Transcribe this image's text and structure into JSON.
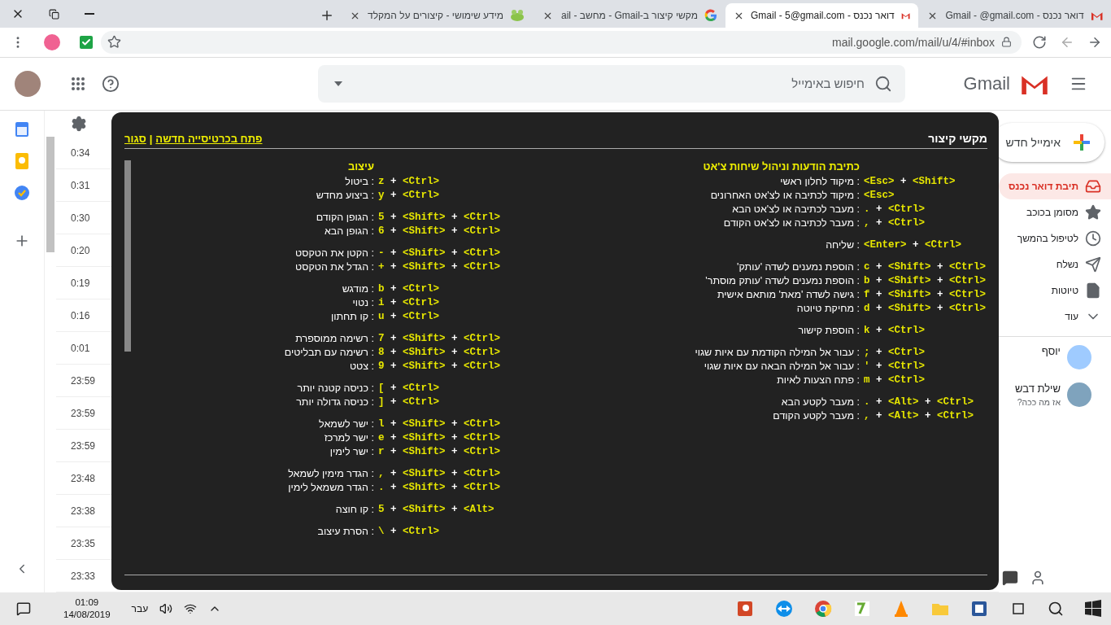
{
  "browser": {
    "tabs": [
      {
        "title": "דואר נכנס - Gmail - @gmail.com",
        "kind": "gmail",
        "selected": false
      },
      {
        "title": "דואר נכנס - Gmail - 5@gmail.com",
        "kind": "gmail",
        "selected": true
      },
      {
        "title": "מקשי קיצור ב-Gmail - מחשב - ail",
        "kind": "google",
        "selected": false
      },
      {
        "title": "מידע שימושי - קיצורים על המקלד",
        "kind": "forum",
        "selected": false
      }
    ],
    "url": "mail.google.com/mail/u/4/#inbox"
  },
  "header": {
    "logo": "Gmail",
    "search_placeholder": "חיפוש באימייל"
  },
  "messages": [
    {
      "time": "0:34"
    },
    {
      "time": "0:31"
    },
    {
      "time": "0:30"
    },
    {
      "time": "0:20"
    },
    {
      "time": "0:19"
    },
    {
      "time": "0:16"
    },
    {
      "time": "0:01"
    },
    {
      "time": "23:59"
    },
    {
      "time": "23:59"
    },
    {
      "time": "23:59"
    },
    {
      "time": "23:48"
    },
    {
      "time": "23:38"
    },
    {
      "time": "23:35"
    },
    {
      "time": "23:33"
    }
  ],
  "sidebar": {
    "compose": "אימייל חדש",
    "items": [
      {
        "label": "תיבת דואר נכנס",
        "kind": "inbox",
        "selected": true
      },
      {
        "label": "מסומן בכוכב",
        "kind": "starred",
        "selected": false
      },
      {
        "label": "לטיפול בהמשך",
        "kind": "snoozed",
        "selected": false
      },
      {
        "label": "נשלח",
        "kind": "sent",
        "selected": false
      },
      {
        "label": "טיוטות",
        "kind": "drafts",
        "selected": false
      },
      {
        "label": "עוד",
        "kind": "more",
        "selected": false
      }
    ],
    "chat": [
      {
        "name": "יוסף",
        "color": "#9fcbff"
      },
      {
        "name": "שילת דבש",
        "status": "אז מה ככה?",
        "color": "#7fa3bd"
      }
    ]
  },
  "shortcuts_dialog": {
    "title": "מקשי קיצור",
    "open_link": "פתח בכרטיסייה חדשה",
    "separator": "|",
    "close_link": "סגור",
    "columns": [
      {
        "heading": "כתיבת הודעות וניהול שיחות צ'אט",
        "groups": [
          [
            {
              "keys": "<Esc> + <Shift>",
              "action": ": מיקוד לחלון ראשי"
            },
            {
              "keys": "<Esc>",
              "action": ": מיקוד לכתיבה או לצ'אט האחרונים"
            },
            {
              "keys": ". + <Ctrl>",
              "action": ": מעבר לכתיבה או לצ'אט הבא"
            },
            {
              "keys": ", + <Ctrl>",
              "action": ": מעבר לכתיבה או לצ'אט הקודם"
            }
          ],
          [
            {
              "keys": "<Enter> + <Ctrl>",
              "action": ": שליחה"
            }
          ],
          [
            {
              "keys": "c + <Shift> + <Ctrl>",
              "action": ": הוספת נמענים לשדה 'עותק'"
            },
            {
              "keys": "b + <Shift> + <Ctrl>",
              "action": ": הוספת נמענים לשדה 'עותק מוסתר'"
            },
            {
              "keys": "f + <Shift> + <Ctrl>",
              "action": ": גישה לשדה 'מאת' מותאם אישית"
            },
            {
              "keys": "d + <Shift> + <Ctrl>",
              "action": ": מחיקת טיוטה"
            }
          ],
          [
            {
              "keys": "k + <Ctrl>",
              "action": ": הוספת קישור"
            }
          ],
          [
            {
              "keys": "; + <Ctrl>",
              "action": ": עבור אל המילה הקודמת עם איות שגוי"
            },
            {
              "keys": "' + <Ctrl>",
              "action": ": עבור אל המילה הבאה עם איות שגוי"
            },
            {
              "keys": "m + <Ctrl>",
              "action": ": פתח הצעות לאיות"
            }
          ],
          [
            {
              "keys": ". + <Alt> + <Ctrl>",
              "action": ": מעבר לקטע הבא"
            },
            {
              "keys": ", + <Alt> + <Ctrl>",
              "action": ": מעבר לקטע הקודם"
            }
          ]
        ]
      },
      {
        "heading": "עיצוב",
        "groups": [
          [
            {
              "keys": "z + <Ctrl>",
              "action": ": ביטול"
            },
            {
              "keys": "y + <Ctrl>",
              "action": ": ביצוע מחדש"
            }
          ],
          [
            {
              "keys": "5 + <Shift> + <Ctrl>",
              "action": ": הגופן הקודם"
            },
            {
              "keys": "6 + <Shift> + <Ctrl>",
              "action": ": הגופן הבא"
            }
          ],
          [
            {
              "keys": "- + <Shift> + <Ctrl>",
              "action": ": הקטן את הטקסט"
            },
            {
              "keys": "+ + <Shift> + <Ctrl>",
              "action": ": הגדל את הטקסט"
            }
          ],
          [
            {
              "keys": "b + <Ctrl>",
              "action": ": מודגש"
            },
            {
              "keys": "i + <Ctrl>",
              "action": ": נטוי"
            },
            {
              "keys": "u + <Ctrl>",
              "action": ": קו תחתון"
            }
          ],
          [
            {
              "keys": "7 + <Shift> + <Ctrl>",
              "action": ": רשימה ממוספרת"
            },
            {
              "keys": "8 + <Shift> + <Ctrl>",
              "action": ": רשימה עם תבליטים"
            },
            {
              "keys": "9 + <Shift> + <Ctrl>",
              "action": ": צטט"
            }
          ],
          [
            {
              "keys": "[ + <Ctrl>",
              "action": ": כניסה קטנה יותר"
            },
            {
              "keys": "] + <Ctrl>",
              "action": ": כניסה גדולה יותר"
            }
          ],
          [
            {
              "keys": "l + <Shift> + <Ctrl>",
              "action": ": ישר לשמאל"
            },
            {
              "keys": "e + <Shift> + <Ctrl>",
              "action": ": ישר למרכז"
            },
            {
              "keys": "r + <Shift> + <Ctrl>",
              "action": ": ישר לימין"
            }
          ],
          [
            {
              "keys": ", + <Shift> + <Ctrl>",
              "action": ": הגדר מימין לשמאל"
            },
            {
              "keys": ". + <Shift> + <Ctrl>",
              "action": ": הגדר משמאל לימין"
            }
          ],
          [
            {
              "keys": "5 + <Shift> + <Alt>",
              "action": ": קו חוצה"
            }
          ],
          [
            {
              "keys": "\\ + <Ctrl>",
              "action": ": הסרת עיצוב"
            }
          ]
        ]
      }
    ]
  },
  "taskbar": {
    "time": "01:09",
    "date": "14/08/2019",
    "language": "עבר"
  }
}
